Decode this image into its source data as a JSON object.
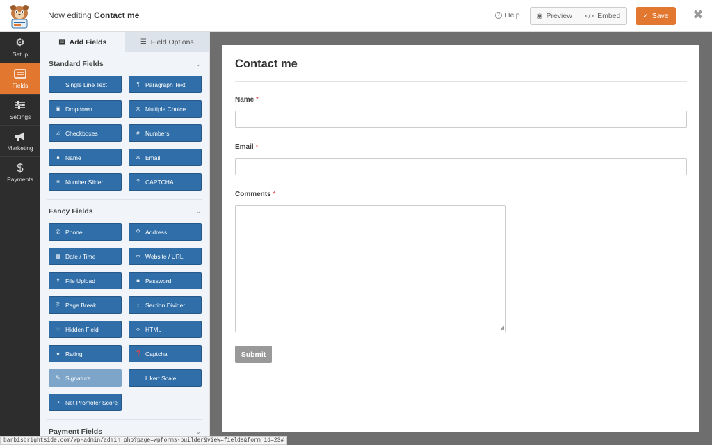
{
  "header": {
    "editing_prefix": "Now editing",
    "form_name": "Contact me",
    "help_label": "Help",
    "preview_label": "Preview",
    "embed_label": "Embed",
    "save_label": "Save"
  },
  "leftnav": {
    "items": [
      {
        "label": "Setup",
        "icon": "gear-icon"
      },
      {
        "label": "Fields",
        "icon": "fields-icon",
        "active": true
      },
      {
        "label": "Settings",
        "icon": "sliders-icon"
      },
      {
        "label": "Marketing",
        "icon": "megaphone-icon"
      },
      {
        "label": "Payments",
        "icon": "dollar-icon"
      }
    ]
  },
  "panel": {
    "tabs": [
      {
        "label": "Add Fields",
        "active": true
      },
      {
        "label": "Field Options",
        "active": false
      }
    ],
    "standard": {
      "title": "Standard Fields",
      "buttons": [
        "Single Line Text",
        "Paragraph Text",
        "Dropdown",
        "Multiple Choice",
        "Checkboxes",
        "Numbers",
        "Name",
        "Email",
        "Number Slider",
        "CAPTCHA"
      ]
    },
    "fancy": {
      "title": "Fancy Fields",
      "buttons": [
        "Phone",
        "Address",
        "Date / Time",
        "Website / URL",
        "File Upload",
        "Password",
        "Page Break",
        "Section Divider",
        "Hidden Field",
        "HTML",
        "Rating",
        "Captcha",
        "Signature",
        "Likert Scale",
        "Net Promoter Score"
      ]
    },
    "payment": {
      "title": "Payment Fields"
    }
  },
  "form": {
    "title": "Contact me",
    "fields": [
      {
        "label": "Name",
        "required_mark": "*"
      },
      {
        "label": "Email",
        "required_mark": "*"
      },
      {
        "label": "Comments",
        "required_mark": "*"
      }
    ],
    "submit_label": "Submit"
  },
  "status_url": "barbisbrightside.com/wp-admin/admin.php?page=wpforms-builder&view=fields&form_id=23#",
  "colors": {
    "accent": "#e27730",
    "field_button": "#2f6ea8",
    "sidebar": "#2d2d2d",
    "preview_bg": "#6e6e6e"
  }
}
